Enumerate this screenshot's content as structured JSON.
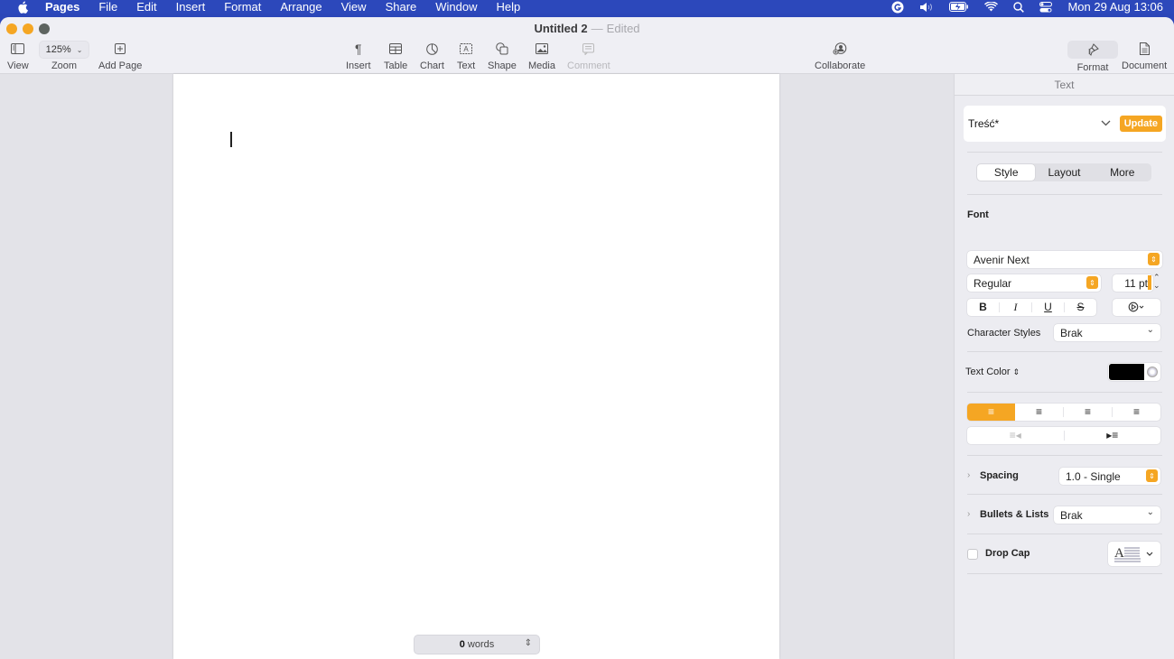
{
  "menubar": {
    "app_name": "Pages",
    "items": [
      "File",
      "Edit",
      "Insert",
      "Format",
      "Arrange",
      "View",
      "Share",
      "Window",
      "Help"
    ],
    "status_icons": [
      "grammarly-icon",
      "volume-icon",
      "battery-charging-icon",
      "wifi-icon",
      "spotlight-search-icon",
      "control-center-icon"
    ],
    "clock": "Mon 29 Aug  13:06"
  },
  "window": {
    "title": "Untitled 2",
    "title_separator": "—",
    "status": "Edited",
    "traffic_colors": {
      "close": "#f5a623",
      "minimize": "#f5a623",
      "zoom": "#5e6460"
    }
  },
  "toolbar": {
    "view_label": "View",
    "zoom_value": "125%",
    "zoom_label": "Zoom",
    "add_page_label": "Add Page",
    "insert_label": "Insert",
    "table_label": "Table",
    "chart_label": "Chart",
    "text_label": "Text",
    "shape_label": "Shape",
    "media_label": "Media",
    "comment_label": "Comment",
    "collaborate_label": "Collaborate",
    "format_label": "Format",
    "document_label": "Document"
  },
  "canvas": {
    "word_count": "0",
    "word_count_unit": "words"
  },
  "sidebar": {
    "header": "Text",
    "paragraph_style": "Treść*",
    "update_label": "Update",
    "tabs": [
      "Style",
      "Layout",
      "More"
    ],
    "active_tab": "Style",
    "font_section": "Font",
    "font_family": "Avenir Next",
    "font_typeface": "Regular",
    "font_size": "11 pt",
    "bius": [
      "B",
      "I",
      "U",
      "S"
    ],
    "character_styles_label": "Character Styles",
    "character_styles_value": "Brak",
    "text_color_label": "Text Color",
    "text_color": "#000000",
    "alignment_active": "left",
    "spacing_label": "Spacing",
    "spacing_value": "1.0 - Single",
    "bullets_label": "Bullets & Lists",
    "bullets_value": "Brak",
    "drop_cap_label": "Drop Cap",
    "drop_cap_checked": false,
    "accent_color": "#f5a623"
  }
}
